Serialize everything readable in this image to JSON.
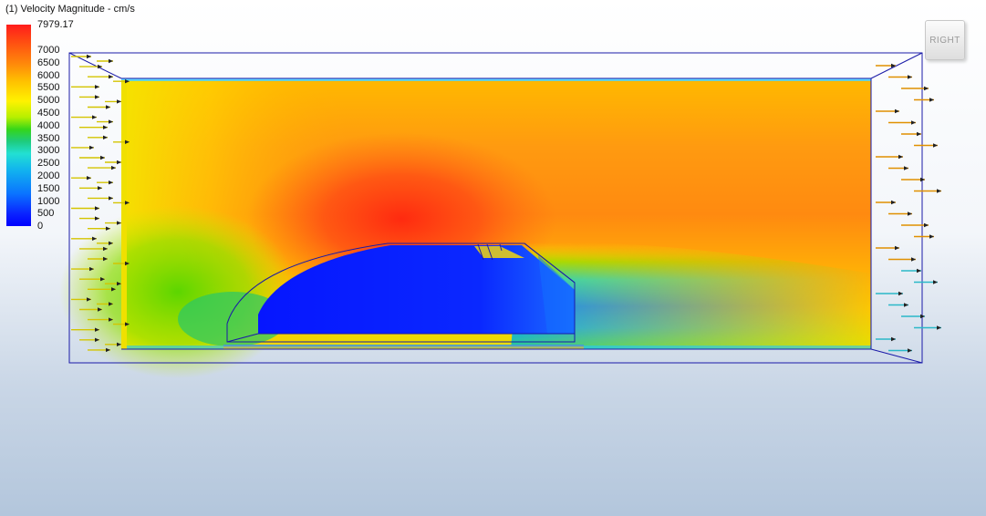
{
  "legend": {
    "title": "(1) Velocity Magnitude - cm/s",
    "max_label": "7979.17",
    "ticks": [
      "7000",
      "6500",
      "6000",
      "5500",
      "5000",
      "4500",
      "4000",
      "3500",
      "3000",
      "2500",
      "2000",
      "1500",
      "1000",
      "500",
      "0"
    ],
    "colors": [
      "#0000ff",
      "#0a73ff",
      "#22e0d2",
      "#35d61a",
      "#fff200",
      "#ff8c0a",
      "#ff1c1c"
    ]
  },
  "view_cube": {
    "face_label": "RIGHT"
  },
  "field": {
    "inlet_arrow_color": "#d4c400",
    "outlet_arrow_colors": [
      "#e09000",
      "#2ab8c8"
    ],
    "frame_color": "#1a1aa8"
  }
}
